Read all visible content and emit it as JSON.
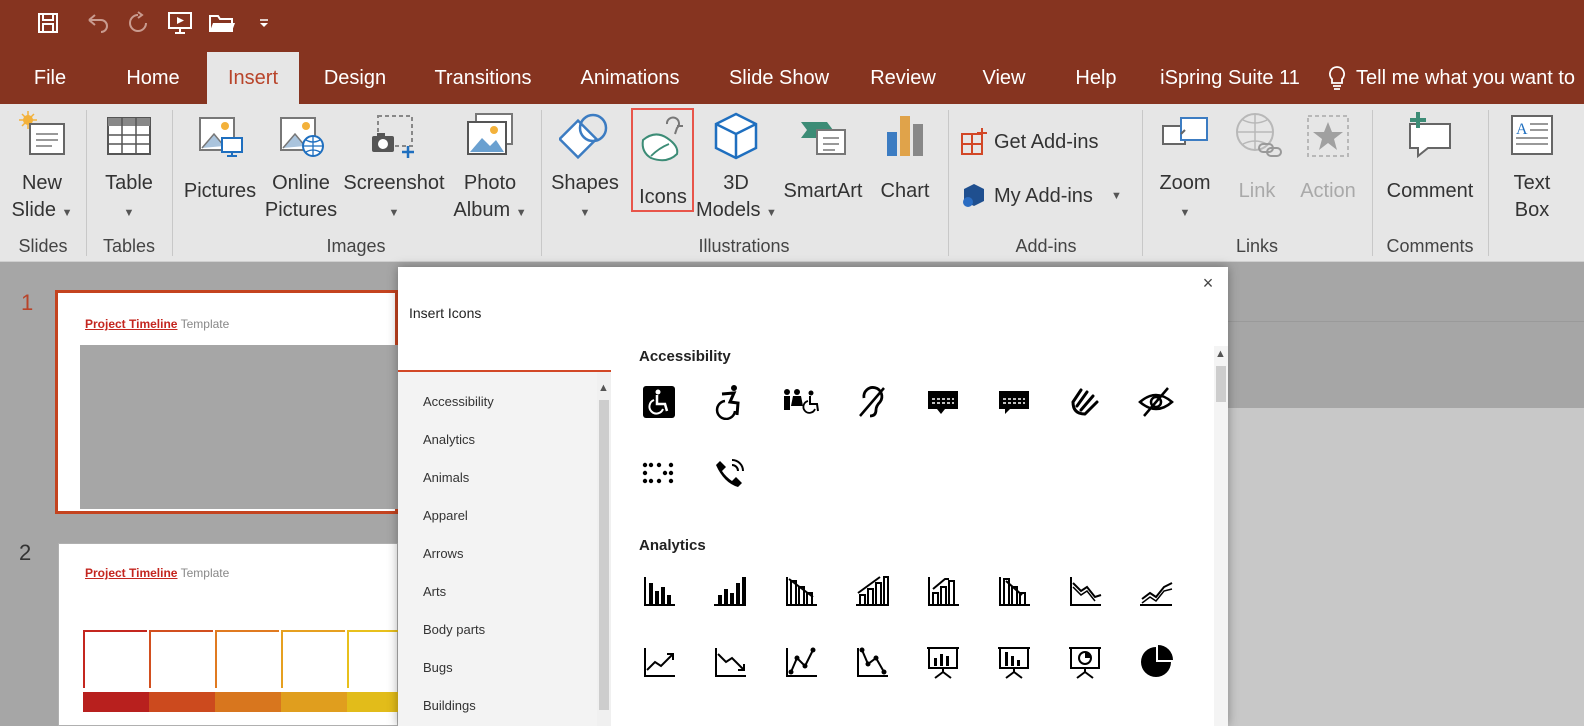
{
  "tabs": [
    "File",
    "Home",
    "Insert",
    "Design",
    "Transitions",
    "Animations",
    "Slide Show",
    "Review",
    "View",
    "Help",
    "iSpring Suite 11"
  ],
  "active_tab": "Insert",
  "tell_me": "Tell me what you want to",
  "ribbon": {
    "new_slide": [
      "New",
      "Slide"
    ],
    "table": "Table",
    "pictures": "Pictures",
    "online_pictures": [
      "Online",
      "Pictures"
    ],
    "screenshot": "Screenshot",
    "photo_album": [
      "Photo",
      "Album"
    ],
    "shapes": "Shapes",
    "icons": "Icons",
    "models": [
      "3D",
      "Models"
    ],
    "smartart": "SmartArt",
    "chart": "Chart",
    "get_addins": "Get Add-ins",
    "my_addins": "My Add-ins",
    "zoom": "Zoom",
    "link": "Link",
    "action": "Action",
    "comment": "Comment",
    "text_box": [
      "Text",
      "Box"
    ],
    "groups": {
      "slides": "Slides",
      "tables": "Tables",
      "images": "Images",
      "illustrations": "Illustrations",
      "addins": "Add-ins",
      "links": "Links",
      "comments": "Comments"
    }
  },
  "slides": [
    {
      "number": "1",
      "title_red": "Project Timeline",
      "title_rest": "Template"
    },
    {
      "number": "2",
      "title_red": "Project Timeline",
      "title_rest": "Template"
    }
  ],
  "dialog": {
    "title": "Insert Icons",
    "close": "×",
    "search_value": "",
    "categories": [
      "Accessibility",
      "Analytics",
      "Animals",
      "Apparel",
      "Arrows",
      "Arts",
      "Body parts",
      "Bugs",
      "Buildings"
    ],
    "sections": [
      {
        "title": "Accessibility",
        "icons": [
          "wheelchair-badge-icon",
          "active-wheelchair-icon",
          "family-accessible-icon",
          "hearing-impaired-icon",
          "closed-caption-icon",
          "caption-bubble-icon",
          "sign-language-icon",
          "low-vision-icon",
          "braille-icon",
          "phone-volume-icon"
        ]
      },
      {
        "title": "Analytics",
        "icons": [
          "bar-chart-icon",
          "bar-chart-up-icon",
          "bar-chart-trend-down-icon",
          "bar-chart-trend-up-icon",
          "bar-chart-arrow-up-icon",
          "bar-chart-arrow-down-icon",
          "line-down-icon",
          "line-up-icon",
          "trend-up-icon",
          "trend-down-icon",
          "line-points-up-icon",
          "line-points-down-icon",
          "presentation-bar-icon",
          "presentation-bar-down-icon",
          "presentation-pie-icon",
          "pie-chart-icon"
        ]
      }
    ]
  }
}
